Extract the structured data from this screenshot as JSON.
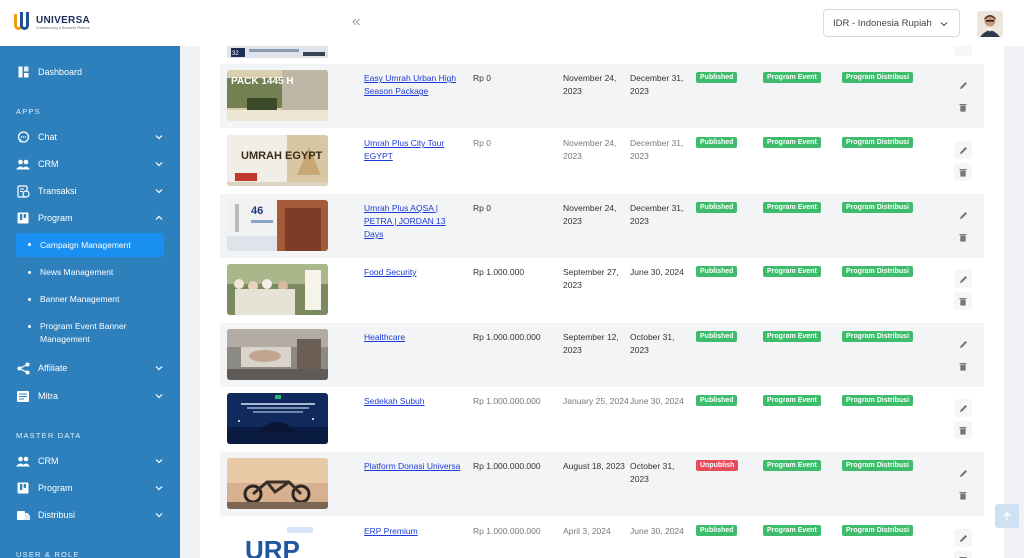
{
  "brand": {
    "name": "UNIVERSA",
    "tagline": "Crowdfunding & Business Platform"
  },
  "sidebar": {
    "dashboard": "Dashboard",
    "apps_label": "APPS",
    "apps": [
      {
        "label": "Chat",
        "icon": "chat-icon"
      },
      {
        "label": "CRM",
        "icon": "users-icon"
      },
      {
        "label": "Transaksi",
        "icon": "transaction-icon"
      },
      {
        "label": "Program",
        "icon": "program-icon"
      }
    ],
    "program_sub": [
      {
        "label": "Campaign Management",
        "active": true
      },
      {
        "label": "News Management"
      },
      {
        "label": "Banner Management"
      },
      {
        "label": "Program Event Banner Management"
      }
    ],
    "apps_more": [
      {
        "label": "Affiliate",
        "icon": "share-icon"
      },
      {
        "label": "Mitra",
        "icon": "list-icon"
      }
    ],
    "master_label": "MASTER DATA",
    "master": [
      {
        "label": "CRM",
        "icon": "users-icon"
      },
      {
        "label": "Program",
        "icon": "program-icon"
      },
      {
        "label": "Distribusi",
        "icon": "distribution-icon"
      }
    ],
    "user_label": "USER & ROLE"
  },
  "topbar": {
    "currency": "IDR - Indonesia Rupiah"
  },
  "campaigns": [
    {
      "title": "Easy Umrah Urban High Season Package",
      "price": "Rp 0",
      "start": "November 24, 2023",
      "end": "December 31, 2023",
      "status": "Published",
      "event": "Program Event",
      "distribution": "Program Distribusi",
      "shaded": true,
      "muted": false
    },
    {
      "title": "Umrah Plus City Tour EGYPT",
      "price": "Rp 0",
      "start": "November 24, 2023",
      "end": "December 31, 2023",
      "status": "Published",
      "event": "Program Event",
      "distribution": "Program Distribusi",
      "shaded": false,
      "muted": true
    },
    {
      "title": "Umrah Plus AQSA | PETRA | JORDAN 13 Days",
      "price": "Rp 0",
      "start": "November 24, 2023",
      "end": "December 31, 2023",
      "status": "Published",
      "event": "Program Event",
      "distribution": "Program Distribusi",
      "shaded": true,
      "muted": false
    },
    {
      "title": "Food Security",
      "price": "Rp 1.000.000",
      "start": "September 27, 2023",
      "end": "June 30, 2024",
      "status": "Published",
      "event": "Program Event",
      "distribution": "Program Distribusi",
      "shaded": false,
      "muted": false
    },
    {
      "title": "Healthcare",
      "price": "Rp 1.000.000.000",
      "start": "September 12, 2023",
      "end": "October 31, 2023",
      "status": "Published",
      "event": "Program Event",
      "distribution": "Program Distribusi",
      "shaded": true,
      "muted": false
    },
    {
      "title": "Sedekah Subuh",
      "price": "Rp 1.000.000.000",
      "start": "January 25, 2024",
      "end": "June 30, 2024",
      "status": "Published",
      "event": "Program Event",
      "distribution": "Program Distribusi",
      "shaded": false,
      "muted": true
    },
    {
      "title": "Platform Donasi Universa",
      "price": "Rp 1.000.000.000",
      "start": "August 18, 2023",
      "end": "October 31, 2023",
      "status": "Unpublish",
      "event": "Program Event",
      "distribution": "Program Distribusi",
      "shaded": true,
      "muted": false
    },
    {
      "title": "ERP Premium",
      "price": "Rp 1.000.000.000",
      "start": "April 3, 2024",
      "end": "June 30, 2024",
      "status": "Published",
      "event": "Program Event",
      "distribution": "Program Distribusi",
      "shaded": false,
      "muted": true
    }
  ],
  "thumb_texts": [
    "PACK 1445 H",
    "UMRAH EGYPT",
    "46"
  ],
  "colors": {
    "sidebar": "#2e80bd",
    "active": "#1a8ff2",
    "published": "#3dbd6c",
    "unpublish": "#e74c5a",
    "link": "#1a3bd6"
  }
}
